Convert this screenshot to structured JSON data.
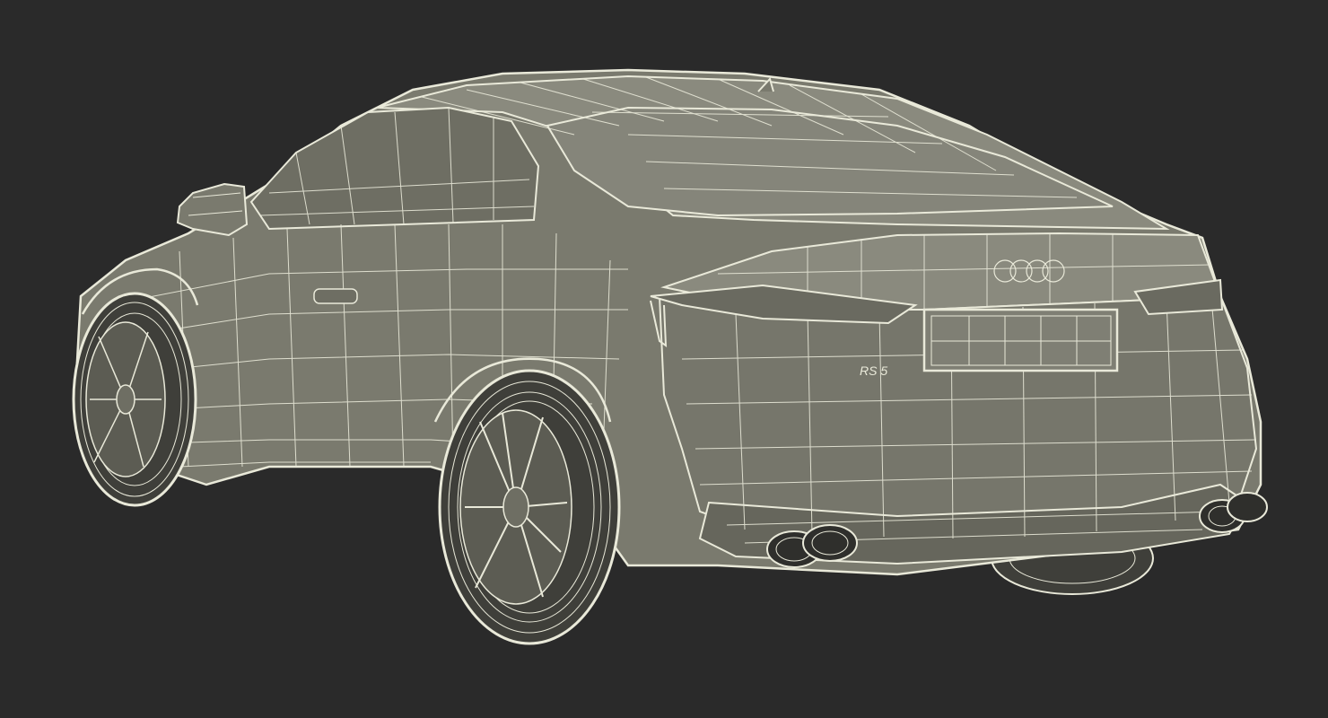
{
  "scene": {
    "subject_icon": "car-wireframe-icon",
    "badge": "RS 5",
    "colors": {
      "background": "#2a2a2a",
      "body_fill": "#7a7a6e",
      "body_fill_light": "#8a8a7e",
      "body_fill_dark": "#66665c",
      "wire": "#e9e9d9",
      "tire": "#3f3f3a",
      "exhaust": "#2f2f2c"
    }
  }
}
